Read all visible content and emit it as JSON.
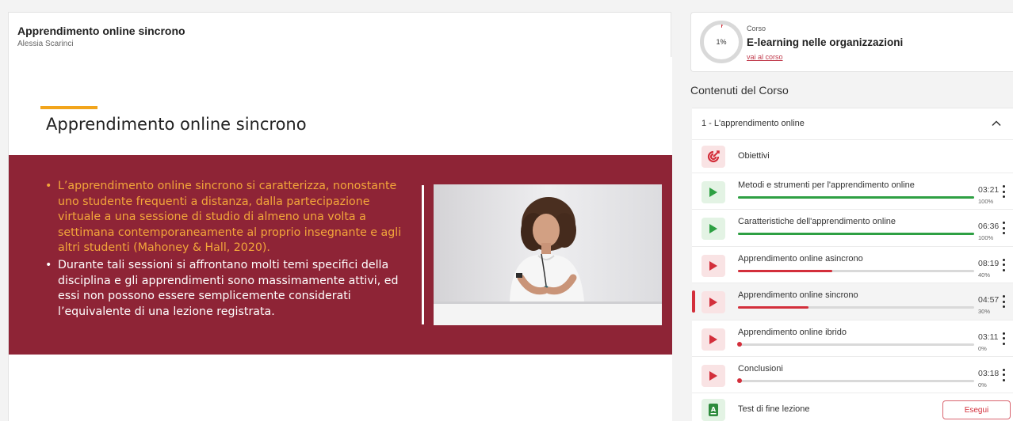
{
  "lesson": {
    "title": "Apprendimento online sincrono",
    "author": "Alessia Scarinci"
  },
  "slide": {
    "title": "Apprendimento online sincrono",
    "bullet_1": "L’apprendimento online sincrono si caratterizza, nonostante uno studente frequenti a distanza, dalla partecipazione virtuale a una sessione di studio di almeno una volta a settimana contemporaneamente al proprio insegnante e agli altri studenti (Mahoney & Hall, 2020).",
    "bullet_2": "Durante tali sessioni si affrontano molti temi specifici della disciplina e gli apprendimenti sono massimamente attivi, ed essi non possono essere semplicemente considerati l’equivalente di una lezione registrata.",
    "colors": {
      "band": "#8e2436",
      "highlight": "#f3a63a",
      "accent": "#f2a51c"
    }
  },
  "course": {
    "progress_label": "1%",
    "progress": 0.01,
    "kicker": "Corso",
    "name": "E-learning nelle organizzazioni",
    "link": "vai al corso"
  },
  "contents_heading": "Contenuti del Corso",
  "module": {
    "title": "1 - L'apprendimento online",
    "expanded": true,
    "objectives": {
      "title": "Obiettivi",
      "icon": "target-icon"
    },
    "items": [
      {
        "title": "Metodi e strumenti per l'apprendimento online",
        "duration": "03:21",
        "percent_label": "100%",
        "progress": 1.0,
        "status": "green",
        "active": false
      },
      {
        "title": "Caratteristiche dell'apprendimento online",
        "duration": "06:36",
        "percent_label": "100%",
        "progress": 1.0,
        "status": "green",
        "active": false
      },
      {
        "title": "Apprendimento online asincrono",
        "duration": "08:19",
        "percent_label": "40%",
        "progress": 0.4,
        "status": "red",
        "active": false
      },
      {
        "title": "Apprendimento online sincrono",
        "duration": "04:57",
        "percent_label": "30%",
        "progress": 0.3,
        "status": "red",
        "active": true
      },
      {
        "title": "Apprendimento online ibrido",
        "duration": "03:11",
        "percent_label": "0%",
        "progress": 0.0,
        "status": "red",
        "active": false
      },
      {
        "title": "Conclusioni",
        "duration": "03:18",
        "percent_label": "0%",
        "progress": 0.0,
        "status": "red",
        "active": false
      }
    ],
    "test": {
      "title": "Test di fine lezione",
      "button": "Esegui",
      "icon": "quiz-document-icon"
    }
  }
}
